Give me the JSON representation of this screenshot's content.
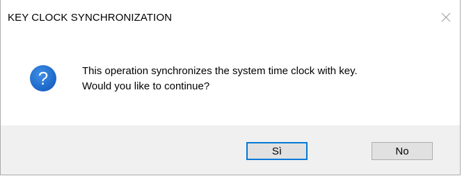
{
  "window": {
    "title": "KEY CLOCK SYNCHRONIZATION",
    "close_icon": "close-icon"
  },
  "message": {
    "icon": "question-icon",
    "icon_color": "#1c6fcf",
    "line1": "This operation synchronizes the system time clock with key.",
    "line2": "Would you like to continue?"
  },
  "buttons": {
    "yes_label": "Sì",
    "no_label": "No",
    "default_border_color": "#0078d7"
  }
}
